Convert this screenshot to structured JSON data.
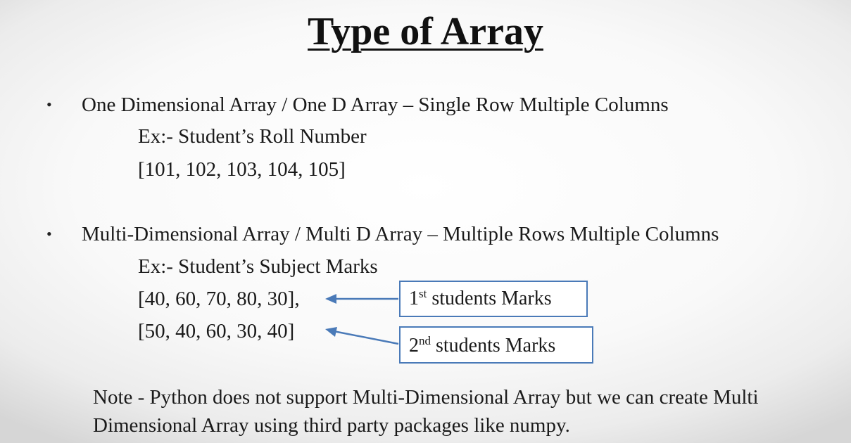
{
  "title": "Type of Array",
  "bullet_symbol": "•",
  "one_d": {
    "heading": "One Dimensional Array / One D Array – Single Row Multiple Columns",
    "example": "Ex:- Student’s Roll Number",
    "values": "[101, 102, 103, 104, 105]"
  },
  "multi_d": {
    "heading": "Multi-Dimensional Array / Multi D Array – Multiple Rows Multiple Columns",
    "example": "Ex:- Student’s Subject Marks",
    "row1": "[40, 60, 70, 80, 30],",
    "row2": "[50, 40, 60, 30, 40]",
    "label1": {
      "num": "1",
      "sup": "st",
      "text": " students Marks"
    },
    "label2": {
      "num": "2",
      "sup": "nd",
      "text": " students Marks"
    }
  },
  "note": "Note - Python does not support Multi-Dimensional Array but we can create Multi Dimensional Array using third party packages like numpy.",
  "colors": {
    "box_border": "#4a7ab8",
    "arrow": "#4a7ab8",
    "text": "#1a1a1a"
  }
}
